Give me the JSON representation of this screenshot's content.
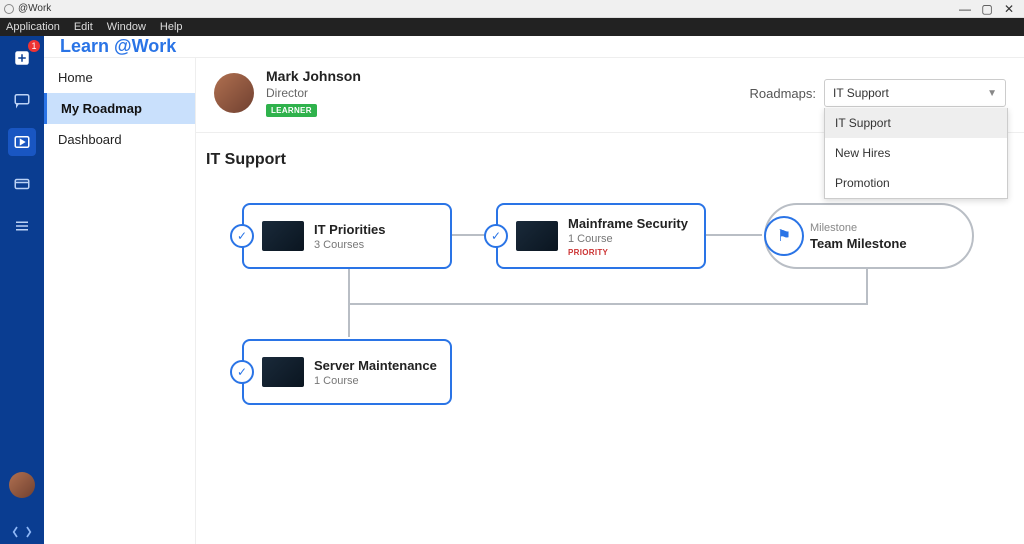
{
  "window": {
    "title": "@Work"
  },
  "menubar": [
    "Application",
    "Edit",
    "Window",
    "Help"
  ],
  "app_title": "Learn @Work",
  "rail": {
    "badge": "1"
  },
  "sidebar": {
    "items": [
      {
        "label": "Home"
      },
      {
        "label": "My Roadmap"
      },
      {
        "label": "Dashboard"
      }
    ]
  },
  "profile": {
    "name": "Mark Johnson",
    "role": "Director",
    "badge": "LEARNER"
  },
  "roadmaps": {
    "label": "Roadmaps:",
    "selected": "IT Support",
    "options": [
      "IT Support",
      "New Hires",
      "Promotion"
    ]
  },
  "section_title": "IT Support",
  "cards": {
    "it_priorities": {
      "title": "IT Priorities",
      "sub": "3 Courses"
    },
    "mainframe": {
      "title": "Mainframe Security",
      "sub": "1 Course",
      "priority": "PRIORITY"
    },
    "server": {
      "title": "Server Maintenance",
      "sub": "1 Course"
    }
  },
  "milestone": {
    "label": "Milestone",
    "title": "Team Milestone"
  }
}
